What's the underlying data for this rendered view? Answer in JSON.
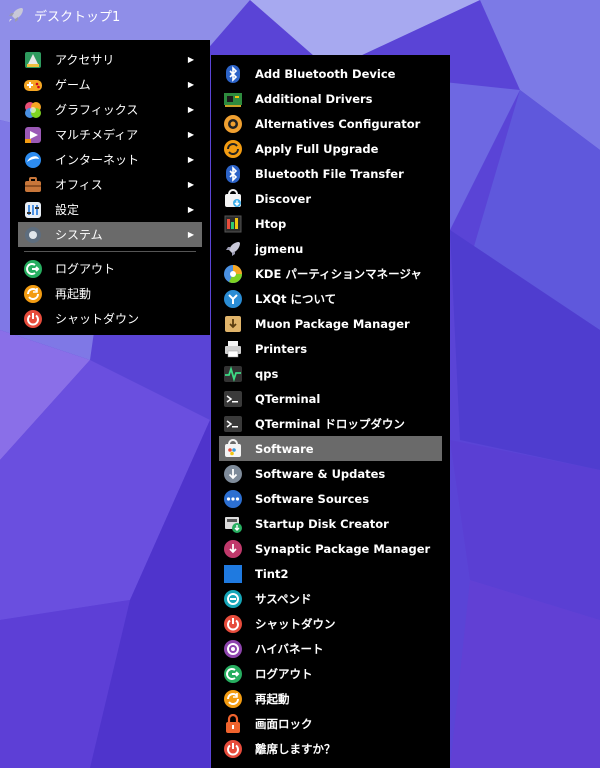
{
  "topbar": {
    "title": "デスクトップ1",
    "icon": "rocket-icon"
  },
  "main_menu": {
    "items": [
      {
        "label": "アクセサリ",
        "icon": "accessories-icon",
        "submenu": true
      },
      {
        "label": "ゲーム",
        "icon": "games-icon",
        "submenu": true
      },
      {
        "label": "グラフィックス",
        "icon": "graphics-icon",
        "submenu": true
      },
      {
        "label": "マルチメディア",
        "icon": "multimedia-icon",
        "submenu": true
      },
      {
        "label": "インターネット",
        "icon": "internet-icon",
        "submenu": true
      },
      {
        "label": "オフィス",
        "icon": "office-icon",
        "submenu": true
      },
      {
        "label": "設定",
        "icon": "settings-icon",
        "submenu": true
      },
      {
        "label": "システム",
        "icon": "system-icon",
        "submenu": true,
        "active": true
      }
    ],
    "session": [
      {
        "label": "ログアウト",
        "icon": "logout-icon"
      },
      {
        "label": "再起動",
        "icon": "reboot-icon"
      },
      {
        "label": "シャットダウン",
        "icon": "shutdown-icon"
      }
    ],
    "submenu_arrow": "▶"
  },
  "system_submenu": {
    "items": [
      {
        "label": "Add Bluetooth Device",
        "icon": "bluetooth-icon"
      },
      {
        "label": "Additional Drivers",
        "icon": "drivers-card-icon"
      },
      {
        "label": "Alternatives Configurator",
        "icon": "alternatives-icon"
      },
      {
        "label": "Apply Full Upgrade",
        "icon": "upgrade-icon"
      },
      {
        "label": "Bluetooth File Transfer",
        "icon": "bluetooth-icon"
      },
      {
        "label": "Discover",
        "icon": "discover-icon"
      },
      {
        "label": "Htop",
        "icon": "htop-icon"
      },
      {
        "label": "jgmenu",
        "icon": "rocket-icon"
      },
      {
        "label": "KDE パーティションマネージャ",
        "icon": "partition-icon"
      },
      {
        "label": "LXQt について",
        "icon": "lxqt-icon"
      },
      {
        "label": "Muon Package Manager",
        "icon": "package-box-icon"
      },
      {
        "label": "Printers",
        "icon": "printer-icon"
      },
      {
        "label": "qps",
        "icon": "qps-monitor-icon"
      },
      {
        "label": "QTerminal",
        "icon": "terminal-icon"
      },
      {
        "label": "QTerminal ドロップダウン",
        "icon": "terminal-icon"
      },
      {
        "label": "Software",
        "icon": "software-store-icon",
        "active": true
      },
      {
        "label": "Software & Updates",
        "icon": "software-updates-icon"
      },
      {
        "label": "Software Sources",
        "icon": "software-sources-icon"
      },
      {
        "label": "Startup Disk Creator",
        "icon": "startup-disk-icon"
      },
      {
        "label": "Synaptic Package Manager",
        "icon": "synaptic-icon"
      },
      {
        "label": "Tint2",
        "icon": "tint2-icon"
      },
      {
        "label": "サスペンド",
        "icon": "suspend-icon"
      },
      {
        "label": "シャットダウン",
        "icon": "shutdown-icon"
      },
      {
        "label": "ハイバネート",
        "icon": "hibernate-icon"
      },
      {
        "label": "ログアウト",
        "icon": "logout-icon"
      },
      {
        "label": "再起動",
        "icon": "reboot-icon"
      },
      {
        "label": "画面ロック",
        "icon": "lock-icon"
      },
      {
        "label": "離席しますか？",
        "icon": "leave-icon"
      }
    ]
  },
  "colors": {
    "menu_bg": "#000000",
    "highlight": "#6a6a6a",
    "wallpaper_base": "#5b45d8"
  }
}
